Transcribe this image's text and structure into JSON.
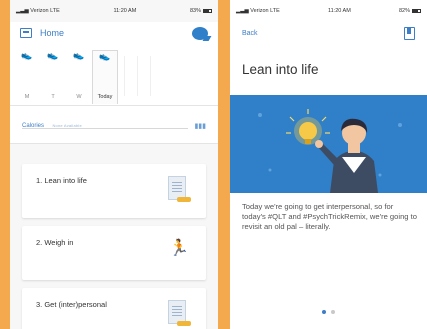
{
  "colors": {
    "background": "#f4a94e",
    "accent": "#3d7ec6",
    "hero": "#2f80c8"
  },
  "left": {
    "status": {
      "carrier": "Verizon",
      "network": "LTE",
      "time": "11:20 AM",
      "battery": "83%"
    },
    "header": {
      "title": "Home",
      "icon": "home-list-icon",
      "chat_icon": "chat-bubble-icon"
    },
    "week": [
      {
        "label": "M",
        "icon": "shoe-icon"
      },
      {
        "label": "T",
        "icon": "shoe-icon"
      },
      {
        "label": "W",
        "icon": "shoe-icon"
      },
      {
        "label": "Today",
        "icon": "shoe-icon"
      }
    ],
    "calories": {
      "label": "Calories",
      "sub": "None Available"
    },
    "cards": [
      {
        "title": "1. Lean into life",
        "icon": "document-icon"
      },
      {
        "title": "2. Weigh in",
        "icon": "person-scale-icon"
      },
      {
        "title": "3. Get (inter)personal",
        "icon": "document-icon"
      }
    ]
  },
  "right": {
    "status": {
      "carrier": "Verizon",
      "network": "LTE",
      "time": "11:20 AM",
      "battery": "82%"
    },
    "header": {
      "back": "Back",
      "bookmark_icon": "bookmark-icon"
    },
    "title": "Lean into life",
    "body": "Today we're going to get interpersonal, so for today's #QLT and #PsychTrickRemix, we're going to revisit an old pal – literally.",
    "pagination": {
      "total": 2,
      "active": 1
    }
  }
}
